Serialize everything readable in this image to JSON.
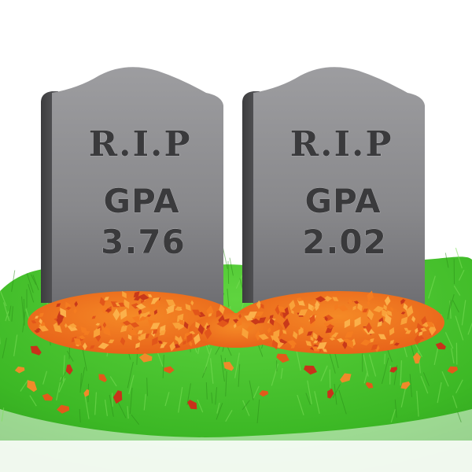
{
  "tombstones": [
    {
      "epitaph": "R.I.P",
      "label": "GPA",
      "value": "3.76"
    },
    {
      "epitaph": "R.I.P",
      "label": "GPA",
      "value": "2.02"
    }
  ],
  "colors": {
    "stone_face": "#8e8e91",
    "stone_side": "#4a4a4c",
    "grass": "#3fbf2a",
    "grass_light": "#7ee05a",
    "leaves": "#f07a1c",
    "leaves_dark": "#d9471a",
    "text": "#3a3a3c"
  }
}
